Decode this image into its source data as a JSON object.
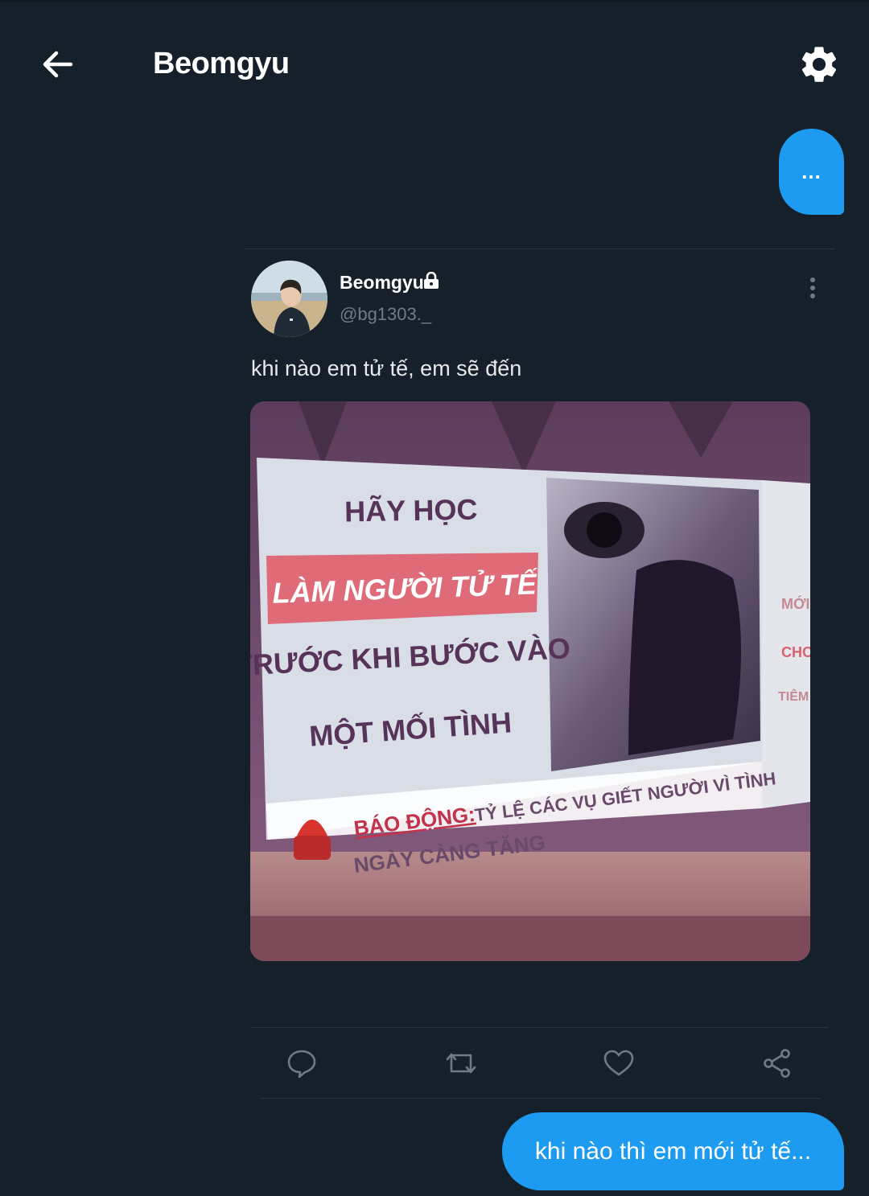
{
  "header": {
    "title": "Beomgyu",
    "back_icon": "arrow-left-icon",
    "settings_icon": "gear-icon"
  },
  "typing_bubble": {
    "text": "..."
  },
  "tweet": {
    "author_name": "Beomgyu",
    "author_handle": "@bg1303._",
    "protected_icon": "lock-icon",
    "text": "khi nào em tử tế, em sẽ đến",
    "image": {
      "banner_line1": "HÃY HỌC",
      "banner_line2": "LÀM NGƯỜI TỬ TẾ",
      "banner_line3": "TRƯỚC KHI BƯỚC VÀO",
      "banner_line4": "MỘT MỐI TÌNH",
      "alert_label": "BÁO ĐỘNG:",
      "alert_text": "TỶ LỆ CÁC VỤ GIẾT NGƯỜI VÌ TÌNH",
      "alert_text2": "NGÀY CÀNG TĂNG",
      "side_text1": "MỚI N",
      "side_text2": "CHO I",
      "side_text3": "TIÊM P"
    },
    "actions": [
      "reply-icon",
      "retweet-icon",
      "like-icon",
      "share-icon"
    ]
  },
  "message": {
    "text": "khi nào thì em mới tử tế..."
  },
  "colors": {
    "background": "#15202b",
    "accent": "#1d9bf0",
    "muted": "#6e7b86",
    "divider": "#2a3640"
  }
}
